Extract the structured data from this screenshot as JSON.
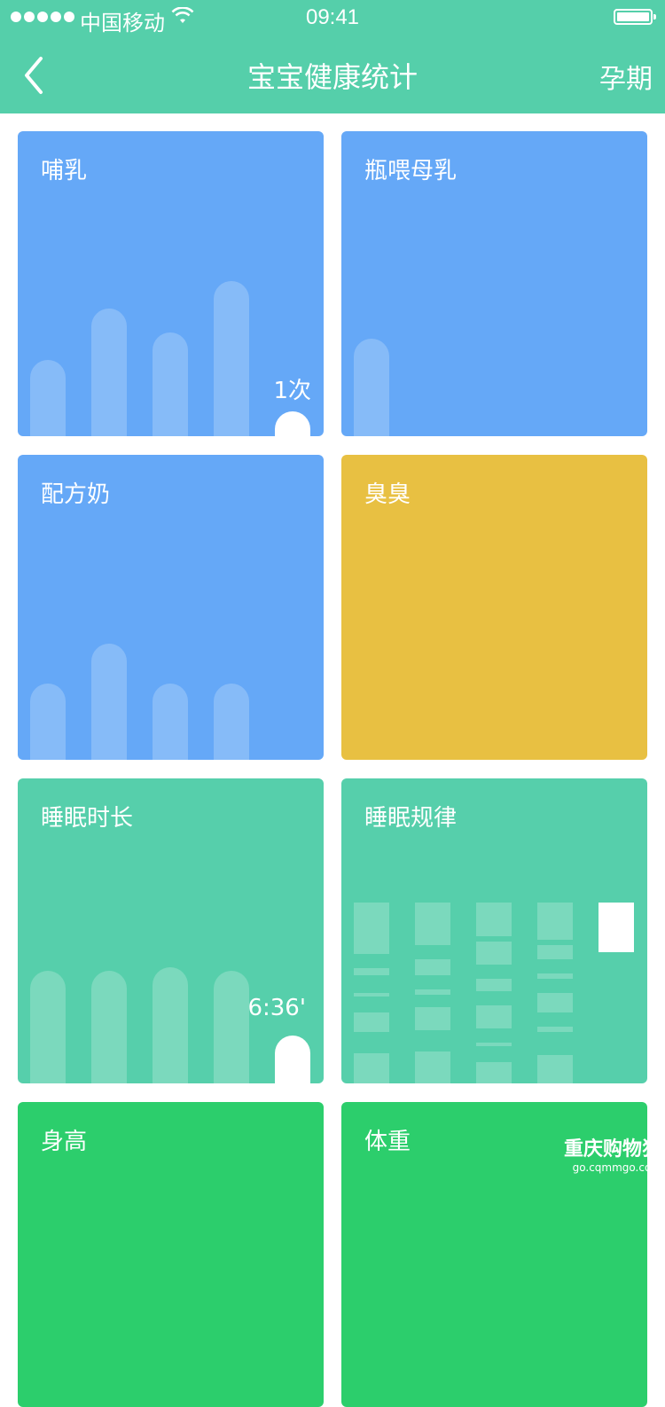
{
  "status_bar": {
    "carrier": "中国移动",
    "time": "09:41"
  },
  "nav": {
    "title": "宝宝健康统计",
    "right_action": "孕期"
  },
  "cards": {
    "breastfeed": {
      "label": "哺乳",
      "value": "1次",
      "bars": [
        0.25,
        0.42,
        0.34,
        0.51
      ]
    },
    "bottle_breastmilk": {
      "label": "瓶喂母乳",
      "bars": [
        0.32
      ]
    },
    "formula": {
      "label": "配方奶",
      "bars": [
        0.25,
        0.38,
        0.25,
        0.25
      ]
    },
    "poop": {
      "label": "臭臭"
    },
    "sleep_duration": {
      "label": "睡眠时长",
      "value": "6:36'",
      "bars": [
        0.37,
        0.37,
        0.38,
        0.37
      ]
    },
    "sleep_pattern": {
      "label": "睡眠规律"
    },
    "height": {
      "label": "身高"
    },
    "weight": {
      "label": "体重"
    }
  },
  "watermark": {
    "main": "重庆购物狂",
    "sub": "go.cqmmgo.com"
  }
}
